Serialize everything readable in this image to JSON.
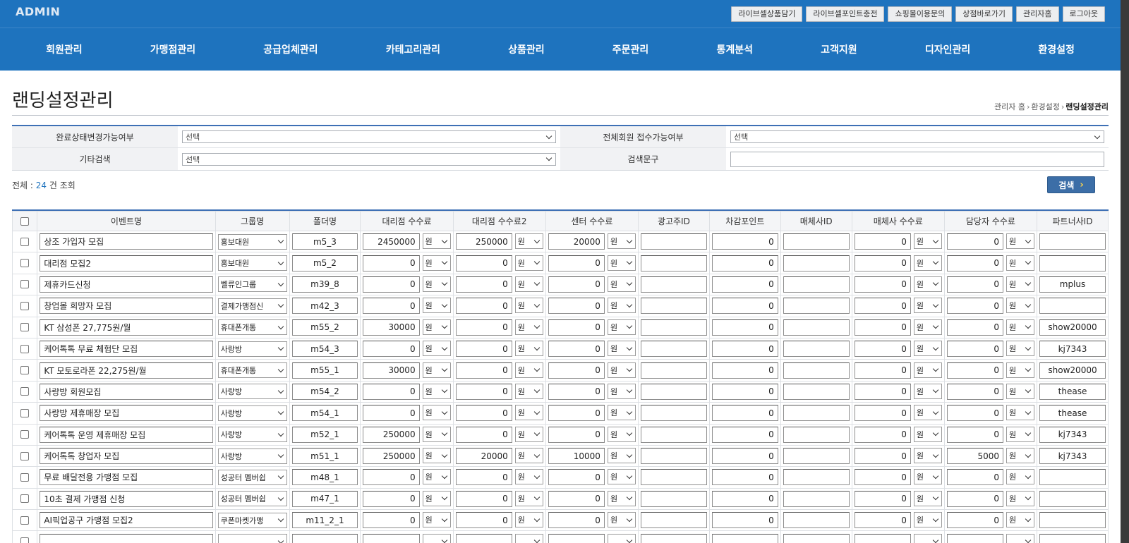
{
  "header": {
    "logo": "ADMIN",
    "top_buttons": [
      "라이브셀상품담기",
      "라이브셀포인트충전",
      "쇼핑몰이용문의",
      "상점바로가기",
      "관리자홈",
      "로그아웃"
    ],
    "menu": [
      "회원관리",
      "가맹점관리",
      "공급업체관리",
      "카테고리관리",
      "상품관리",
      "주문관리",
      "통계분석",
      "고객지원",
      "디자인관리",
      "환경설정"
    ]
  },
  "page": {
    "title": "랜딩설정관리",
    "breadcrumb": [
      "관리자 홈",
      "환경설정",
      "랜딩설정관리"
    ]
  },
  "search": {
    "row1": {
      "label1": "완료상태변경가능여부",
      "value1": "선택",
      "label2": "전체회원 접수가능여부",
      "value2": "선택"
    },
    "row2": {
      "label1": "기타검색",
      "value1": "선택",
      "label2": "검색문구",
      "value2": ""
    },
    "count_prefix": "전체 : ",
    "count": "24",
    "count_suffix": " 건 조회",
    "button": "검색"
  },
  "grid": {
    "columns": [
      "이벤트명",
      "그룹명",
      "폴더명",
      "대리점 수수료",
      "대리점 수수료2",
      "센터 수수료",
      "광고주ID",
      "차감포인트",
      "매체사ID",
      "매체사 수수료",
      "담당자 수수료",
      "파트너사ID"
    ],
    "rows": [
      {
        "event": "상조 가입자 모집",
        "group": "홍보대원",
        "folder": "m5_3",
        "fee1": "2450000",
        "unit1": "원",
        "fee2": "250000",
        "unit2": "원",
        "fee3": "20000",
        "unit3": "원",
        "advertiser": "",
        "points": "0",
        "media": "",
        "mediafee": "0",
        "unit4": "원",
        "managerfee": "0",
        "unit5": "원",
        "partner": ""
      },
      {
        "event": "대리점 모집2",
        "group": "홍보대원",
        "folder": "m5_2",
        "fee1": "0",
        "unit1": "원",
        "fee2": "0",
        "unit2": "원",
        "fee3": "0",
        "unit3": "원",
        "advertiser": "",
        "points": "0",
        "media": "",
        "mediafee": "0",
        "unit4": "원",
        "managerfee": "0",
        "unit5": "원",
        "partner": ""
      },
      {
        "event": "제휴카드신청",
        "group": "벨류인그룹",
        "folder": "m39_8",
        "fee1": "0",
        "unit1": "원",
        "fee2": "0",
        "unit2": "원",
        "fee3": "0",
        "unit3": "원",
        "advertiser": "",
        "points": "0",
        "media": "",
        "mediafee": "0",
        "unit4": "원",
        "managerfee": "0",
        "unit5": "원",
        "partner": "mplus"
      },
      {
        "event": "창업몰 희망자 모집",
        "group": "결제가맹점신",
        "folder": "m42_3",
        "fee1": "0",
        "unit1": "원",
        "fee2": "0",
        "unit2": "원",
        "fee3": "0",
        "unit3": "원",
        "advertiser": "",
        "points": "0",
        "media": "",
        "mediafee": "0",
        "unit4": "원",
        "managerfee": "0",
        "unit5": "원",
        "partner": ""
      },
      {
        "event": "KT 삼성폰 27,775원/월",
        "group": "휴대폰개통",
        "folder": "m55_2",
        "fee1": "30000",
        "unit1": "원",
        "fee2": "0",
        "unit2": "원",
        "fee3": "0",
        "unit3": "원",
        "advertiser": "",
        "points": "0",
        "media": "",
        "mediafee": "0",
        "unit4": "원",
        "managerfee": "0",
        "unit5": "원",
        "partner": "show20000"
      },
      {
        "event": "케어톡톡 무료 체험단 모집",
        "group": "사랑방",
        "folder": "m54_3",
        "fee1": "0",
        "unit1": "원",
        "fee2": "0",
        "unit2": "원",
        "fee3": "0",
        "unit3": "원",
        "advertiser": "",
        "points": "0",
        "media": "",
        "mediafee": "0",
        "unit4": "원",
        "managerfee": "0",
        "unit5": "원",
        "partner": "kj7343"
      },
      {
        "event": "KT 모토로라폰 22,275원/월",
        "group": "휴대폰개통",
        "folder": "m55_1",
        "fee1": "30000",
        "unit1": "원",
        "fee2": "0",
        "unit2": "원",
        "fee3": "0",
        "unit3": "원",
        "advertiser": "",
        "points": "0",
        "media": "",
        "mediafee": "0",
        "unit4": "원",
        "managerfee": "0",
        "unit5": "원",
        "partner": "show20000"
      },
      {
        "event": "사랑방 회원모집",
        "group": "사랑방",
        "folder": "m54_2",
        "fee1": "0",
        "unit1": "원",
        "fee2": "0",
        "unit2": "원",
        "fee3": "0",
        "unit3": "원",
        "advertiser": "",
        "points": "0",
        "media": "",
        "mediafee": "0",
        "unit4": "원",
        "managerfee": "0",
        "unit5": "원",
        "partner": "thease"
      },
      {
        "event": "사랑방 제휴매장 모집",
        "group": "사랑방",
        "folder": "m54_1",
        "fee1": "0",
        "unit1": "원",
        "fee2": "0",
        "unit2": "원",
        "fee3": "0",
        "unit3": "원",
        "advertiser": "",
        "points": "0",
        "media": "",
        "mediafee": "0",
        "unit4": "원",
        "managerfee": "0",
        "unit5": "원",
        "partner": "thease"
      },
      {
        "event": "케어톡톡 운영 제휴매장 모집",
        "group": "사랑방",
        "folder": "m52_1",
        "fee1": "250000",
        "unit1": "원",
        "fee2": "0",
        "unit2": "원",
        "fee3": "0",
        "unit3": "원",
        "advertiser": "",
        "points": "0",
        "media": "",
        "mediafee": "0",
        "unit4": "원",
        "managerfee": "0",
        "unit5": "원",
        "partner": "kj7343"
      },
      {
        "event": "케어톡톡 창업자 모집",
        "group": "사랑방",
        "folder": "m51_1",
        "fee1": "250000",
        "unit1": "원",
        "fee2": "20000",
        "unit2": "원",
        "fee3": "10000",
        "unit3": "원",
        "advertiser": "",
        "points": "0",
        "media": "",
        "mediafee": "0",
        "unit4": "원",
        "managerfee": "5000",
        "unit5": "원",
        "partner": "kj7343"
      },
      {
        "event": "무료 배달전용 가맹점 모집",
        "group": "성공터 멤버쉽",
        "folder": "m48_1",
        "fee1": "0",
        "unit1": "원",
        "fee2": "0",
        "unit2": "원",
        "fee3": "0",
        "unit3": "원",
        "advertiser": "",
        "points": "0",
        "media": "",
        "mediafee": "0",
        "unit4": "원",
        "managerfee": "0",
        "unit5": "원",
        "partner": ""
      },
      {
        "event": "10초 결제 가맹점 신청",
        "group": "성공터 멤버쉽",
        "folder": "m47_1",
        "fee1": "0",
        "unit1": "원",
        "fee2": "0",
        "unit2": "원",
        "fee3": "0",
        "unit3": "원",
        "advertiser": "",
        "points": "0",
        "media": "",
        "mediafee": "0",
        "unit4": "원",
        "managerfee": "0",
        "unit5": "원",
        "partner": ""
      },
      {
        "event": "AI픽업공구 가맹점 모집2",
        "group": "쿠폰마켓가맹",
        "folder": "m11_2_1",
        "fee1": "0",
        "unit1": "원",
        "fee2": "0",
        "unit2": "원",
        "fee3": "0",
        "unit3": "원",
        "advertiser": "",
        "points": "0",
        "media": "",
        "mediafee": "0",
        "unit4": "원",
        "managerfee": "0",
        "unit5": "원",
        "partner": ""
      },
      {
        "event": "",
        "group": "",
        "folder": "",
        "fee1": "",
        "unit1": "",
        "fee2": "",
        "unit2": "",
        "fee3": "",
        "unit3": "",
        "advertiser": "",
        "points": "",
        "media": "",
        "mediafee": "",
        "unit4": "",
        "managerfee": "",
        "unit5": "",
        "partner": ""
      }
    ]
  }
}
